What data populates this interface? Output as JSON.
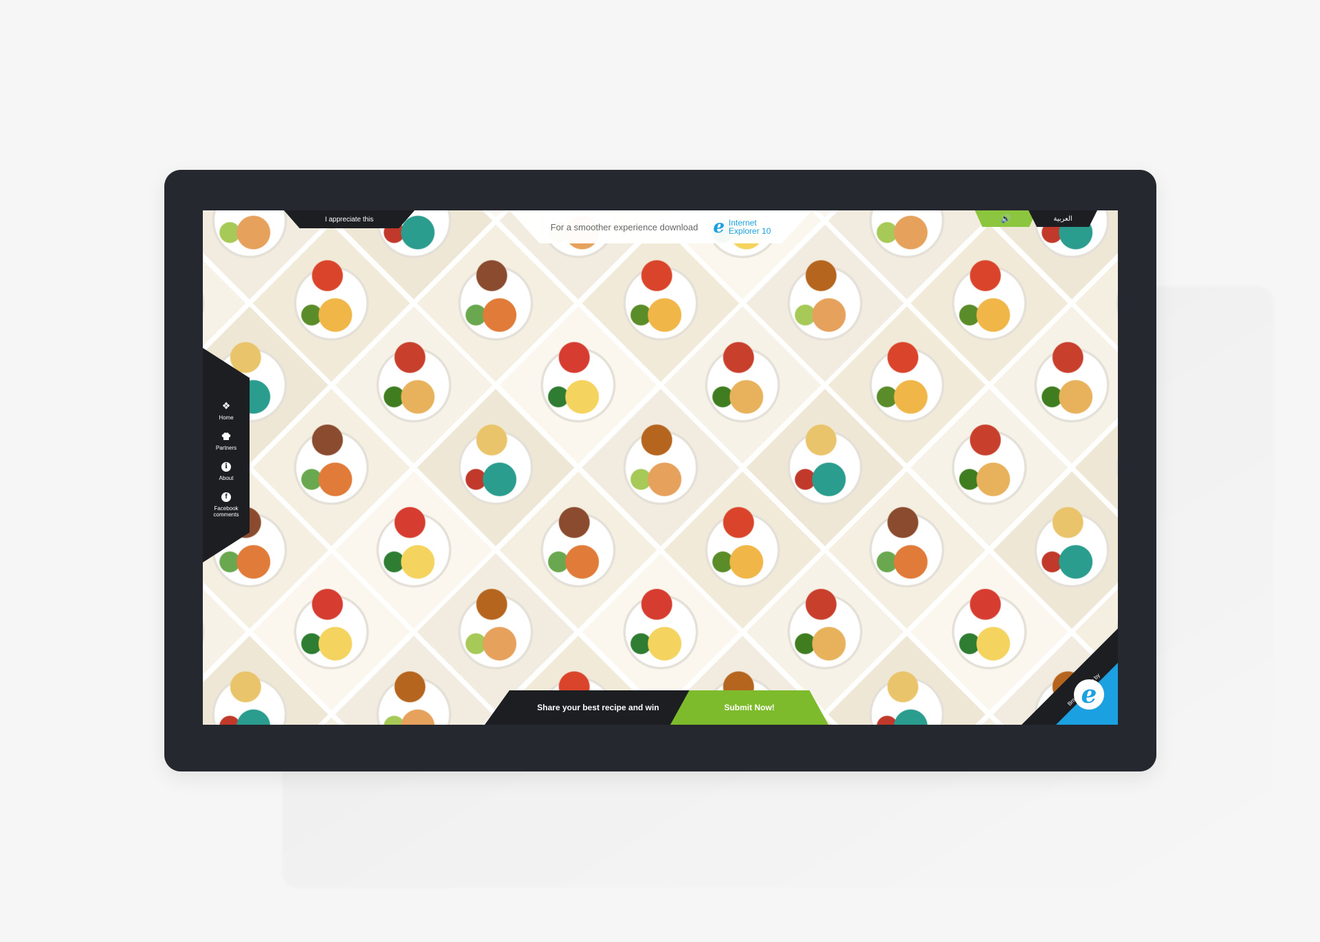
{
  "top": {
    "appreciate_label": "I appreciate this",
    "ie_message": "For a smoother experience download",
    "ie_brand_line1": "Internet",
    "ie_brand_line2": "Explorer 10",
    "sound_icon": "speaker-icon",
    "language_label": "العربية"
  },
  "sidebar": {
    "items": [
      {
        "label": "Home",
        "icon": "home-icon"
      },
      {
        "label": "Partners",
        "icon": "chef-hat-icon"
      },
      {
        "label": "About",
        "icon": "info-icon"
      },
      {
        "label": "Facebook comments",
        "icon": "facebook-icon"
      }
    ]
  },
  "bottom": {
    "share_text": "Share your best recipe and win",
    "submit_label": "Submit Now!"
  },
  "corner": {
    "brought_text": "Brought to you by",
    "logo_icon": "internet-explorer-icon"
  },
  "colors": {
    "accent_green": "#7dbb2d",
    "ie_blue": "#1ba1e2",
    "bar_dark": "#1d1e22",
    "device_frame": "#262830"
  }
}
